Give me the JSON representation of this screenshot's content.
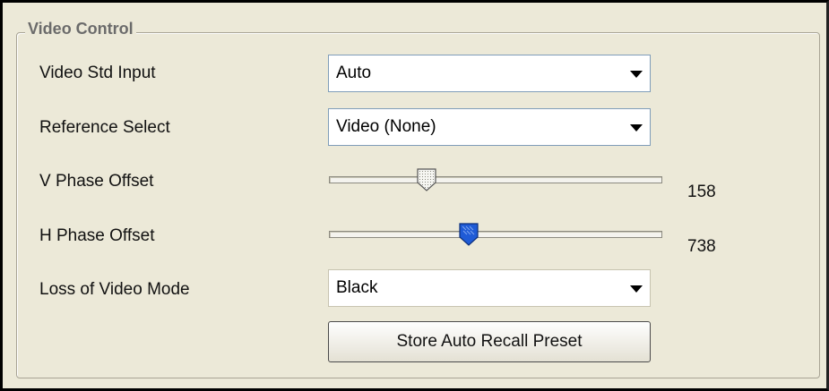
{
  "group": {
    "title": "Video Control"
  },
  "video_std_input": {
    "label": "Video Std Input",
    "selected": "Auto"
  },
  "reference_select": {
    "label": "Reference Select",
    "selected": "Video (None)"
  },
  "v_phase_offset": {
    "label": "V Phase Offset",
    "value": "158",
    "thumb_style": "dotted-white"
  },
  "h_phase_offset": {
    "label": "H Phase Offset",
    "value": "738",
    "thumb_style": "blue"
  },
  "loss_of_video_mode": {
    "label": "Loss of Video Mode",
    "selected": "Black"
  },
  "store_button": {
    "label": "Store Auto Recall Preset"
  },
  "colors": {
    "background": "#ece9d8",
    "blue_thumb": "#1f5bd6",
    "border": "#000000"
  }
}
